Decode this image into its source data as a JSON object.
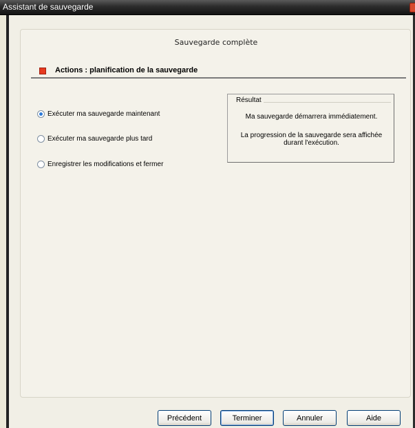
{
  "window": {
    "title": "Assistant de sauvegarde"
  },
  "panel": {
    "title": "Sauvegarde complète"
  },
  "section": {
    "label": "Actions : planification de la sauvegarde"
  },
  "options": [
    {
      "label": "Exécuter ma sauvegarde maintenant",
      "checked": true
    },
    {
      "label": "Exécuter ma sauvegarde plus tard",
      "checked": false
    },
    {
      "label": "Enregistrer les modifications et fermer",
      "checked": false
    }
  ],
  "result": {
    "title": "Résultat",
    "line1": "Ma sauvegarde démarrera immédiatement.",
    "line2": "La progression de la sauvegarde sera affichée",
    "line3": "durant l'exécution."
  },
  "buttons": {
    "previous": "Précédent",
    "finish": "Terminer",
    "cancel": "Annuler",
    "help": "Aide"
  },
  "colors": {
    "section_icon": "#e63a1f",
    "selected_radio": "#2e7bd8"
  }
}
